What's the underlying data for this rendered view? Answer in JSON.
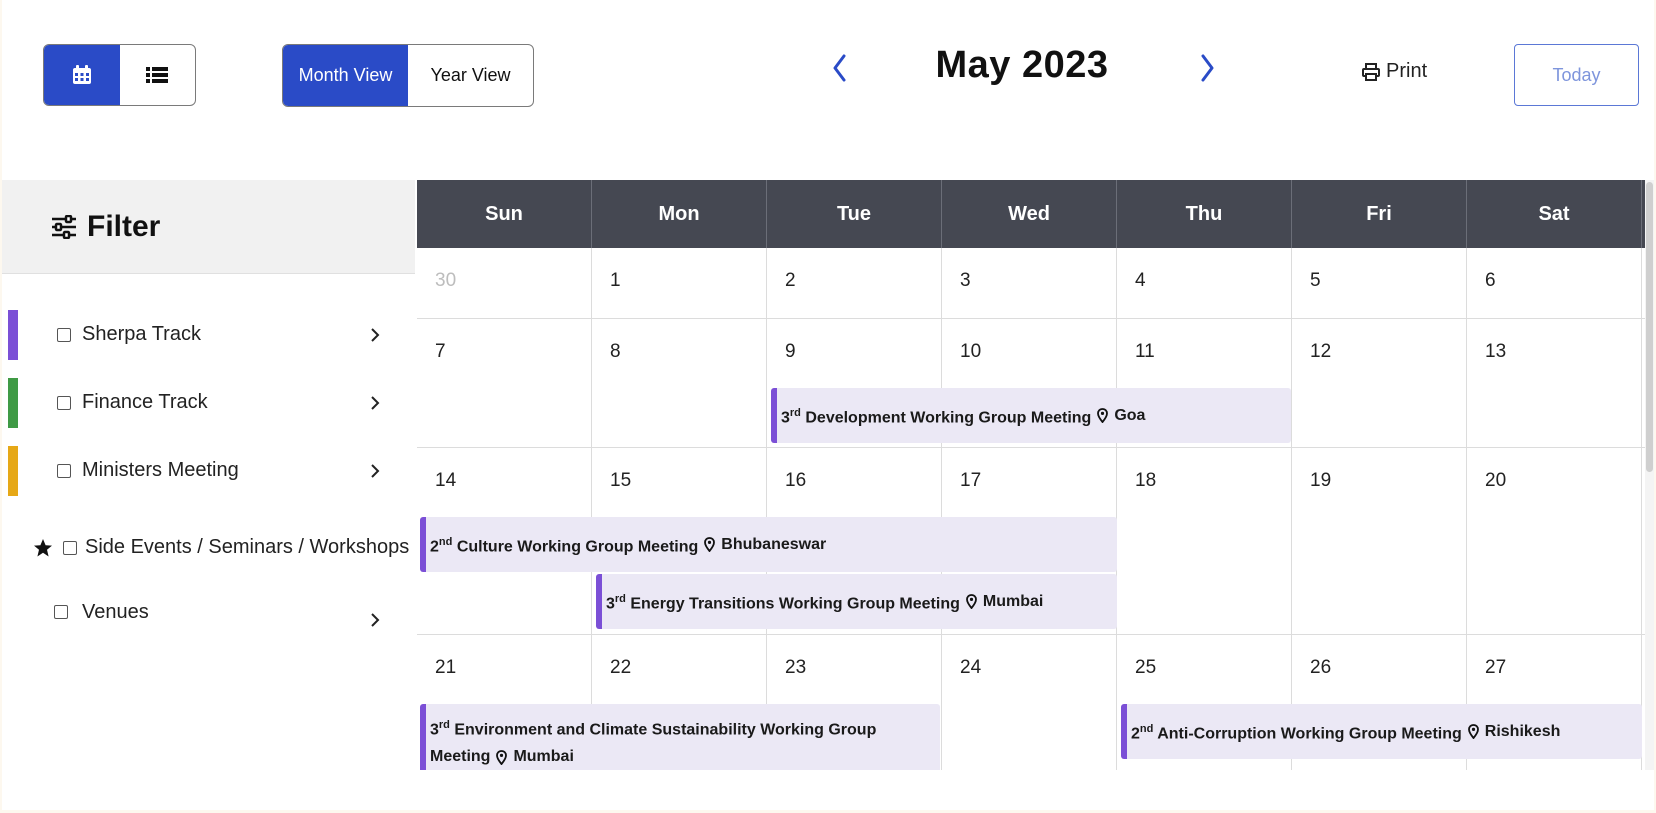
{
  "toolbar": {
    "calendar_view_icon": "calendar-icon",
    "list_view_icon": "list-icon",
    "month_view_label": "Month View",
    "year_view_label": "Year View",
    "prev_icon": "chevron-left-icon",
    "next_icon": "chevron-right-icon",
    "current_month": "May 2023",
    "print_label": "Print",
    "today_label": "Today"
  },
  "sidebar": {
    "title": "Filter",
    "items": [
      {
        "label": "Sherpa Track",
        "color": "#7b4fd6",
        "checked": false,
        "icon": "chevron-right-icon"
      },
      {
        "label": "Finance Track",
        "color": "#3f9a45",
        "checked": false,
        "icon": "chevron-right-icon"
      },
      {
        "label": "Ministers Meeting",
        "color": "#e6a817",
        "checked": false,
        "icon": "chevron-right-icon"
      },
      {
        "label": "Side Events / Seminars / Workshops",
        "color": "",
        "checked": false,
        "icon": "star-icon"
      },
      {
        "label": "Venues",
        "color": "",
        "checked": false,
        "icon": "chevron-right-icon"
      }
    ]
  },
  "calendar": {
    "days_of_week": [
      "Sun",
      "Mon",
      "Tue",
      "Wed",
      "Thu",
      "Fri",
      "Sat"
    ],
    "weeks": [
      [
        "30",
        "1",
        "2",
        "3",
        "4",
        "5",
        "6"
      ],
      [
        "7",
        "8",
        "9",
        "10",
        "11",
        "12",
        "13"
      ],
      [
        "14",
        "15",
        "16",
        "17",
        "18",
        "19",
        "20"
      ],
      [
        "21",
        "22",
        "23",
        "24",
        "25",
        "26",
        "27"
      ]
    ],
    "events": [
      {
        "ordinal": "3",
        "suffix": "rd",
        "title": "Development Working Group Meeting",
        "location": "Goa"
      },
      {
        "ordinal": "2",
        "suffix": "nd",
        "title": "Culture Working Group Meeting",
        "location": "Bhubaneswar"
      },
      {
        "ordinal": "3",
        "suffix": "rd",
        "title": "Energy Transitions Working Group Meeting",
        "location": "Mumbai"
      },
      {
        "ordinal": "3",
        "suffix": "rd",
        "title": "Environment and Climate Sustainability Working Group Meeting",
        "location": "Mumbai"
      },
      {
        "ordinal": "2",
        "suffix": "nd",
        "title": "Anti-Corruption Working Group Meeting",
        "location": "Rishikesh"
      }
    ]
  },
  "colors": {
    "accent": "#2a4bc7",
    "header_bg": "#454852",
    "event_bg": "#ebe8f5",
    "event_border": "#7b4fd6"
  }
}
